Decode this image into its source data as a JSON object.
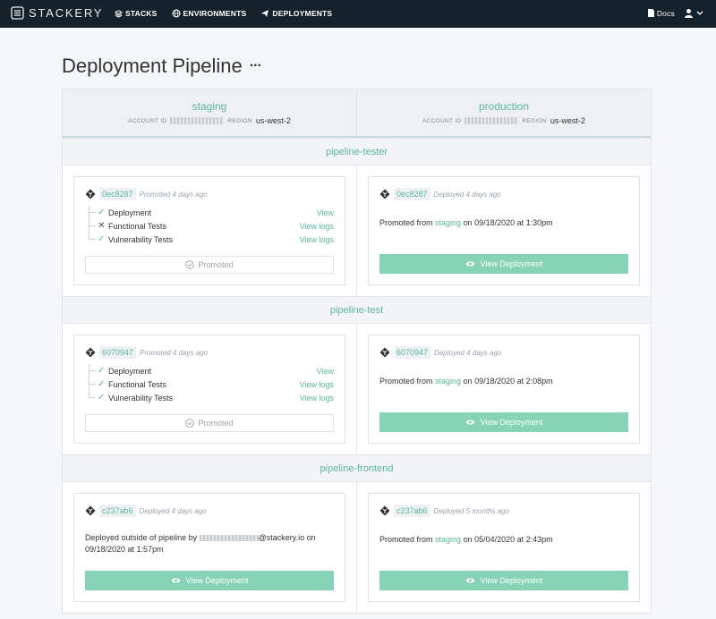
{
  "app": {
    "logo": "STACKERY",
    "nav": [
      {
        "label": "STACKS",
        "icon": "stacks-icon"
      },
      {
        "label": "ENVIRONMENTS",
        "icon": "globe-icon"
      },
      {
        "label": "DEPLOYMENTS",
        "icon": "paper-plane-icon"
      }
    ],
    "docs_label": "Docs"
  },
  "page": {
    "title": "Deployment Pipeline",
    "more_label": "···"
  },
  "environments": [
    {
      "name": "staging",
      "account_label": "ACCOUNT ID",
      "region_label": "REGION",
      "region": "us-west-2"
    },
    {
      "name": "production",
      "account_label": "ACCOUNT ID",
      "region_label": "REGION",
      "region": "us-west-2"
    }
  ],
  "pipelines": [
    {
      "name": "pipeline-tester",
      "staging": {
        "commit": "0ec8287",
        "note": "Promoted 4 days ago",
        "checks": [
          {
            "label": "Deployment",
            "status": "pass",
            "link": "View"
          },
          {
            "label": "Functional Tests",
            "status": "fail",
            "link": "View logs"
          },
          {
            "label": "Vulnerability Tests",
            "status": "pass",
            "link": "View logs"
          }
        ],
        "button": "Promoted"
      },
      "production": {
        "commit": "0ec8287",
        "note": "Deployed 4 days ago",
        "prefix": "Promoted from ",
        "from": "staging",
        "suffix": " on 09/18/2020 at 1:30pm",
        "button": "View Deployment"
      }
    },
    {
      "name": "pipeline-test",
      "staging": {
        "commit": "6070947",
        "note": "Promoted 4 days ago",
        "checks": [
          {
            "label": "Deployment",
            "status": "pass",
            "link": "View"
          },
          {
            "label": "Functional Tests",
            "status": "pass",
            "link": "View logs"
          },
          {
            "label": "Vulnerability Tests",
            "status": "pass",
            "link": "View logs"
          }
        ],
        "button": "Promoted"
      },
      "production": {
        "commit": "6070947",
        "note": "Deployed 4 days ago",
        "prefix": "Promoted from ",
        "from": "staging",
        "suffix": " on 09/18/2020 at 2:08pm",
        "button": "View Deployment"
      }
    },
    {
      "name": "pipeline-frontend",
      "staging": {
        "commit": "c237ab6",
        "note": "Deployed 4 days ago",
        "text_before": "Deployed outside of pipeline by ",
        "email_domain": "@stackery.io on",
        "text_after": "09/18/2020 at 1:57pm",
        "button": "View Deployment"
      },
      "production": {
        "commit": "c237ab6",
        "note": "Deployed 5 months ago",
        "prefix": "Promoted from ",
        "from": "staging",
        "suffix": " on 05/04/2020 at 2:43pm",
        "button": "View Deployment"
      }
    }
  ],
  "colors": {
    "accent": "#5ab99a",
    "button": "#86d3b5",
    "topbar": "#16222b"
  }
}
